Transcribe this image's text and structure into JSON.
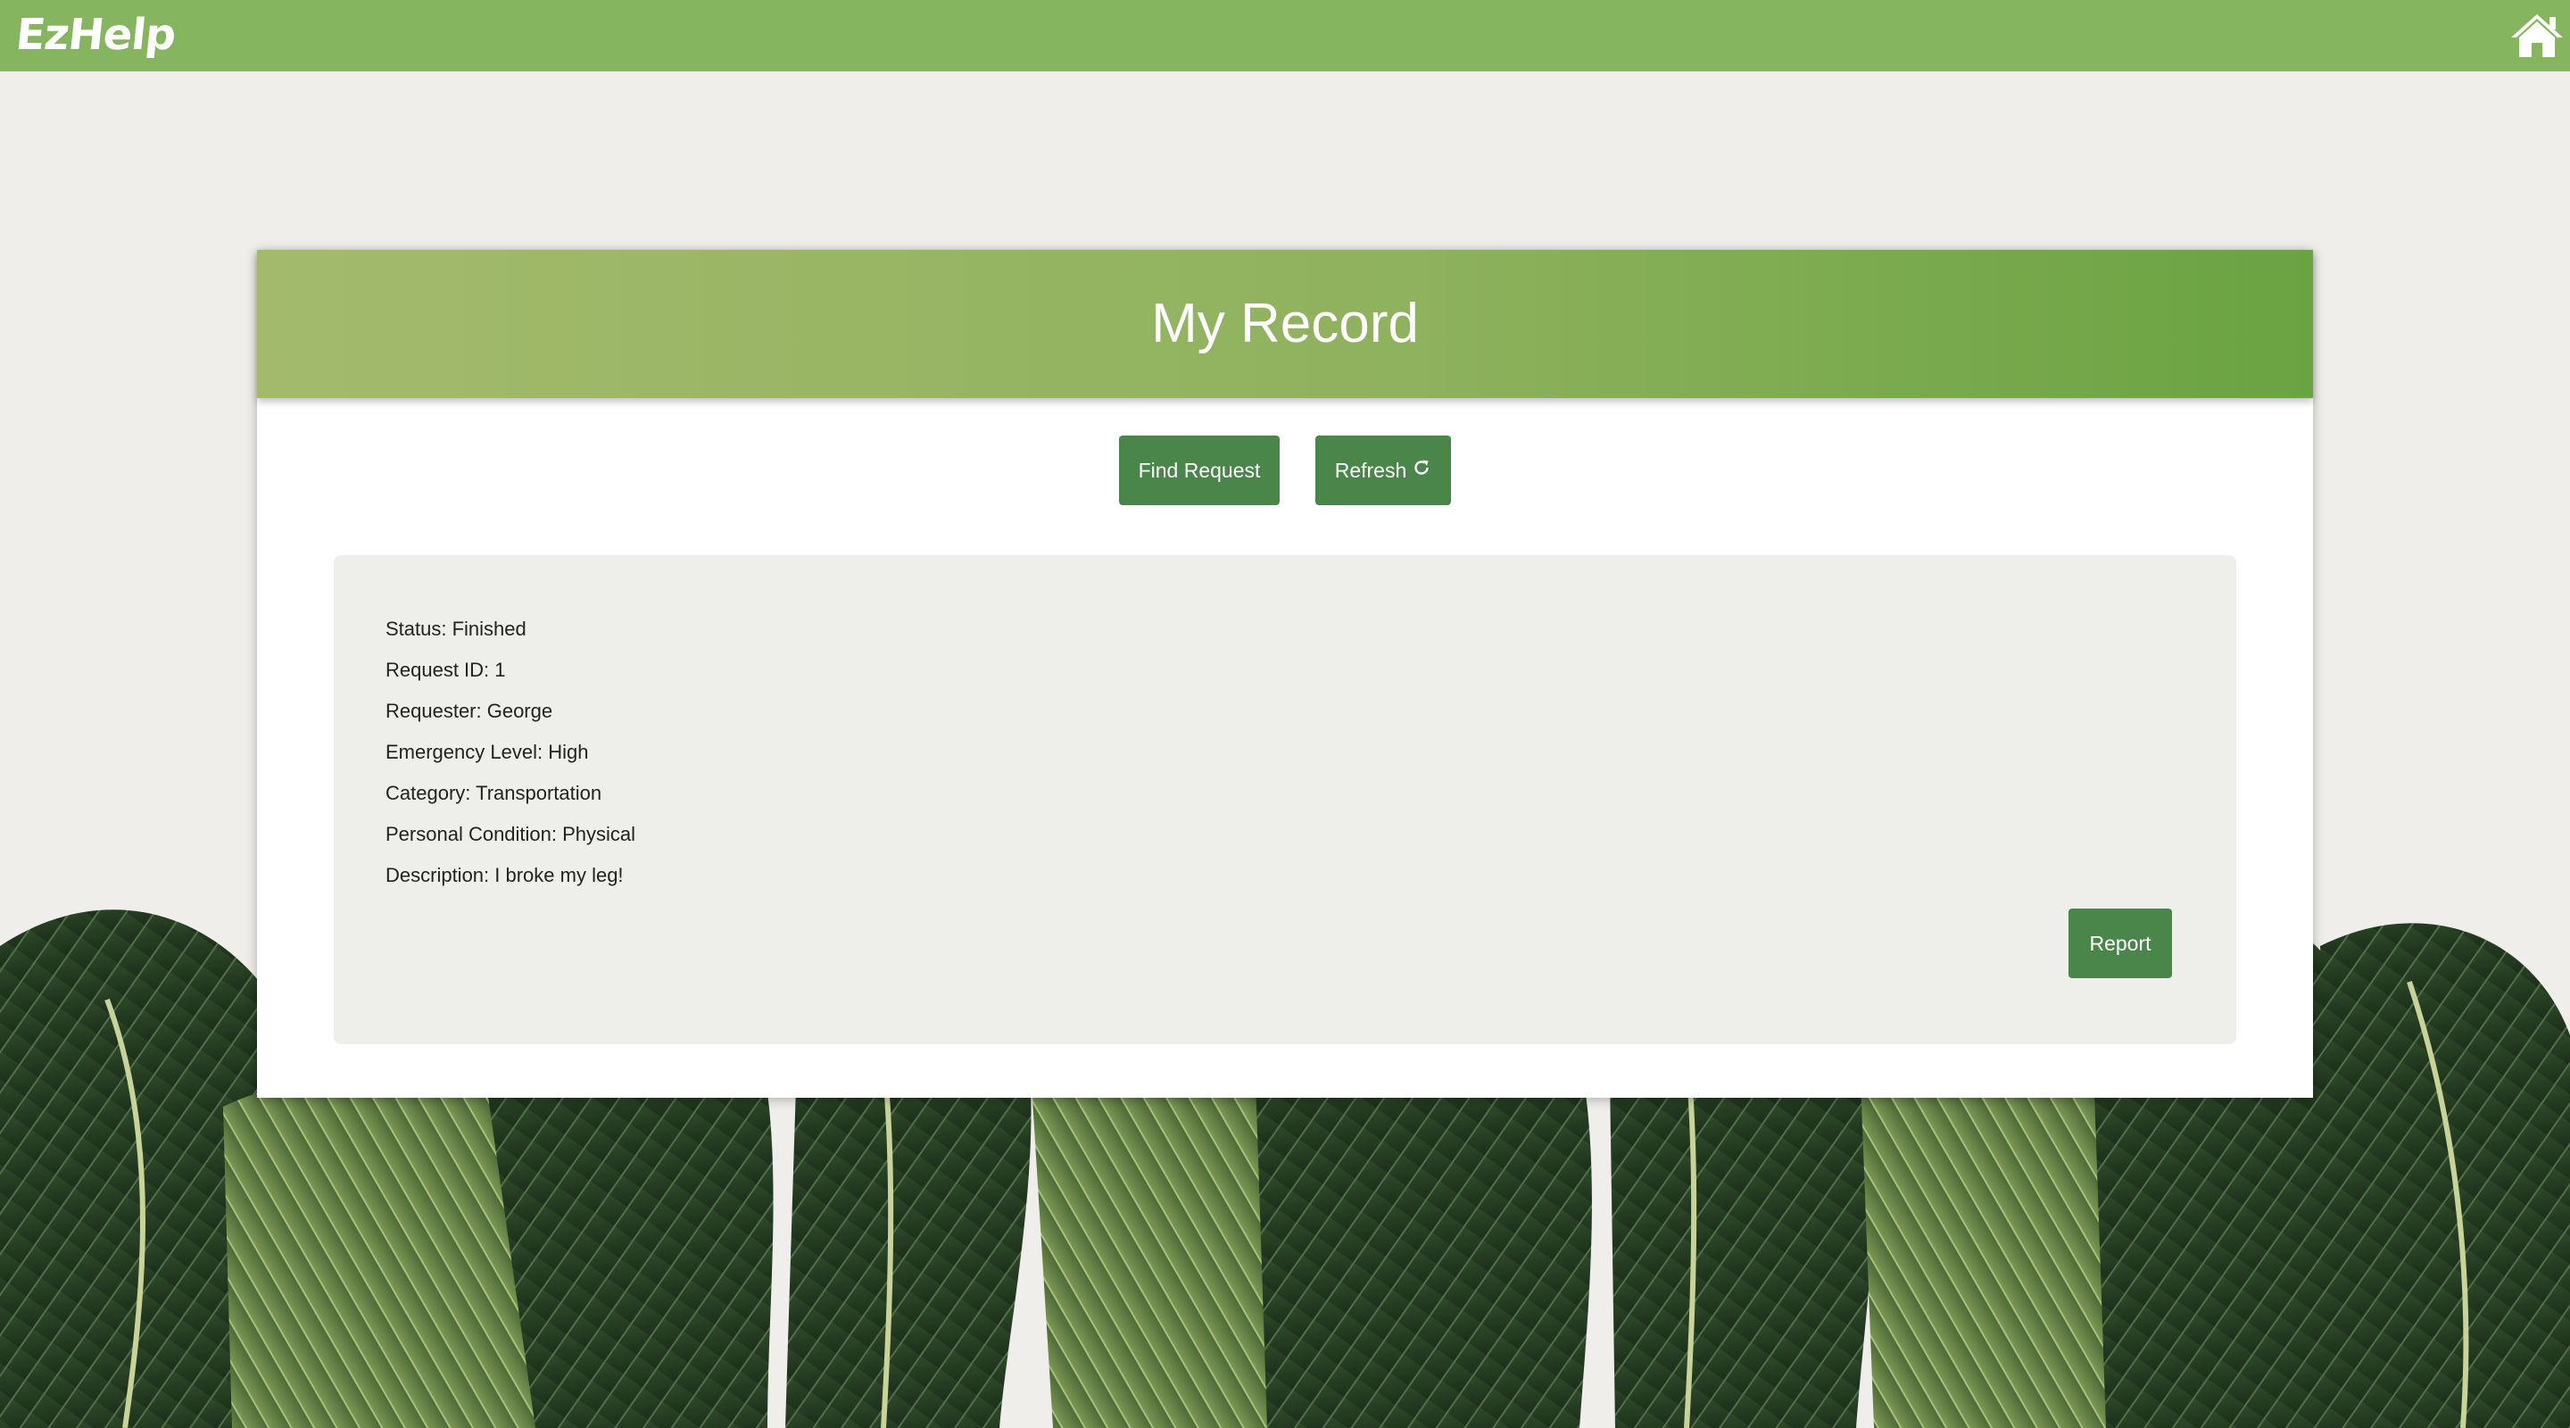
{
  "app": {
    "logo_text": "EzHelp",
    "home_icon": "home-icon"
  },
  "colors": {
    "navbar": "#86b55f",
    "header_start": "#a3ba6c",
    "header_end": "#6aa341",
    "button": "#4a8549",
    "panel": "#eeeeea",
    "page_background": "#efeeeb"
  },
  "card": {
    "title": "My Record",
    "buttons": {
      "find_request": "Find Request",
      "refresh": "Refresh",
      "refresh_icon": "refresh-icon"
    },
    "record": {
      "status": "Status: Finished",
      "request_id": "Request ID: 1",
      "requester": "Requester: George",
      "emergency_level": "Emergency Level: High",
      "category": "Category: Transportation",
      "personal_condition": "Personal Condition: Physical",
      "description": "Description: I broke my leg!"
    },
    "report_button": "Report"
  }
}
